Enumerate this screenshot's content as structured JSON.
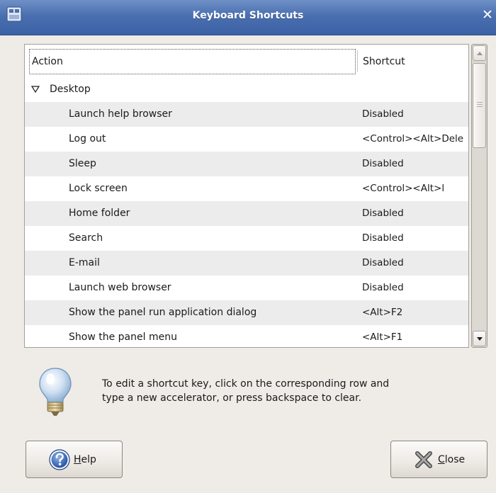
{
  "window": {
    "title": "Keyboard Shortcuts",
    "close_glyph": "✕"
  },
  "tree": {
    "headers": {
      "action": "Action",
      "shortcut": "Shortcut"
    },
    "rows": [
      {
        "type": "category",
        "action": "Desktop",
        "shortcut": "",
        "expanded": true
      },
      {
        "type": "item",
        "action": "Launch help browser",
        "shortcut": "Disabled"
      },
      {
        "type": "item",
        "action": "Log out",
        "shortcut": "<Control><Alt>Dele"
      },
      {
        "type": "item",
        "action": "Sleep",
        "shortcut": "Disabled"
      },
      {
        "type": "item",
        "action": "Lock screen",
        "shortcut": "<Control><Alt>l"
      },
      {
        "type": "item",
        "action": "Home folder",
        "shortcut": "Disabled"
      },
      {
        "type": "item",
        "action": "Search",
        "shortcut": "Disabled"
      },
      {
        "type": "item",
        "action": "E-mail",
        "shortcut": "Disabled"
      },
      {
        "type": "item",
        "action": "Launch web browser",
        "shortcut": "Disabled"
      },
      {
        "type": "item",
        "action": "Show the panel run application dialog",
        "shortcut": "<Alt>F2"
      },
      {
        "type": "item",
        "action": "Show the panel menu",
        "shortcut": "<Alt>F1"
      }
    ]
  },
  "hint": {
    "icon": "lightbulb-icon",
    "lines": [
      "To edit a shortcut key, click on the corresponding row and",
      "type a new accelerator, or press backspace to clear."
    ]
  },
  "buttons": {
    "help": {
      "mnemonic": "H",
      "rest": "elp",
      "icon": "help-icon"
    },
    "close": {
      "mnemonic": "C",
      "rest": "lose",
      "icon": "close-x-icon"
    }
  },
  "colors": {
    "titlebar": "#4a6fb0",
    "alt_row": "#ececec",
    "window_bg": "#efebe7"
  }
}
